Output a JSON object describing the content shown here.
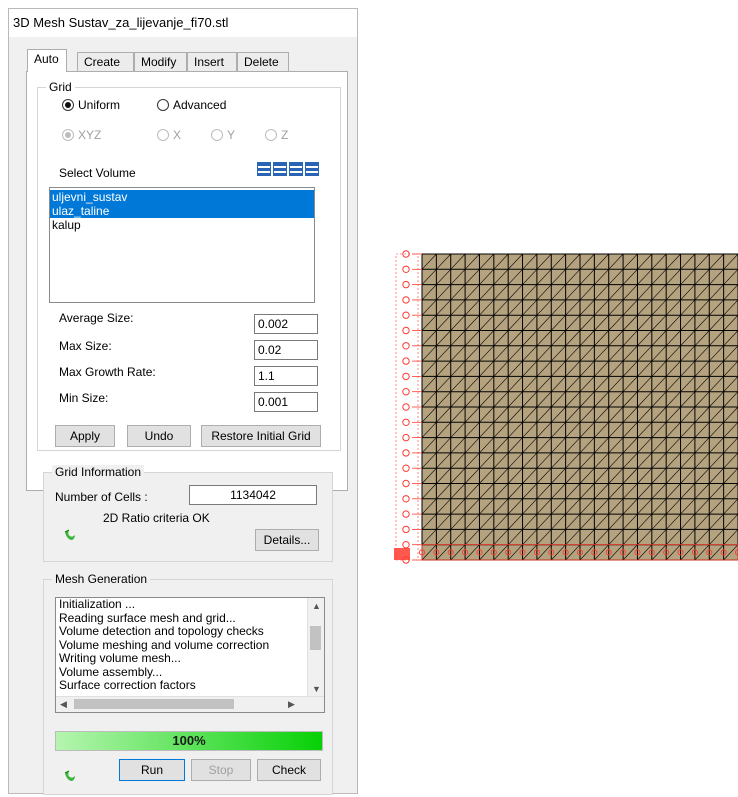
{
  "window": {
    "title": "3D Mesh Sustav_za_lijevanje_fi70.stl"
  },
  "tabs": [
    {
      "label": "Auto",
      "active": true
    },
    {
      "label": "Create",
      "active": false
    },
    {
      "label": "Modify",
      "active": false
    },
    {
      "label": "Insert",
      "active": false
    },
    {
      "label": "Delete",
      "active": false
    }
  ],
  "grid": {
    "legend": "Grid",
    "mode_options": [
      {
        "label": "Uniform",
        "checked": true
      },
      {
        "label": "Advanced",
        "checked": false
      }
    ],
    "axis_options": [
      {
        "label": "XYZ",
        "checked": true
      },
      {
        "label": "X",
        "checked": false
      },
      {
        "label": "Y",
        "checked": false
      },
      {
        "label": "Z",
        "checked": false
      }
    ],
    "select_volume_label": "Select Volume",
    "volumes": [
      {
        "label": "uljevni_sustav",
        "selected": true
      },
      {
        "label": "ulaz_taline",
        "selected": true
      },
      {
        "label": "kalup",
        "selected": false
      }
    ],
    "fields": [
      {
        "label": "Average Size:",
        "value": "0.002"
      },
      {
        "label": "Max Size:",
        "value": "0.02"
      },
      {
        "label": "Max Growth Rate:",
        "value": "1.1"
      },
      {
        "label": "Min Size:",
        "value": "0.001"
      }
    ],
    "buttons": {
      "apply": "Apply",
      "undo": "Undo",
      "restore": "Restore Initial Grid"
    }
  },
  "grid_info": {
    "legend": "Grid Information",
    "cells_label": "Number of Cells :",
    "cells_value": "1134042",
    "ratio_text": "2D Ratio criteria OK",
    "details_button": "Details..."
  },
  "mesh_generation": {
    "legend": "Mesh Generation",
    "log": [
      "Initialization ...",
      "Reading surface mesh and grid...",
      "Volume detection and topology checks",
      "Volume meshing and volume correction",
      "Writing volume mesh...",
      "Volume assembly...",
      "Surface correction factors"
    ],
    "progress_percent": 100,
    "progress_text": "100%",
    "buttons": {
      "run": "Run",
      "stop": "Stop",
      "check": "Check"
    }
  },
  "mesh_view": {
    "fill_color": "#b5a27e",
    "line_color": "#000000",
    "label_color": "#ff3b30",
    "columns": 22,
    "rows": 20
  }
}
